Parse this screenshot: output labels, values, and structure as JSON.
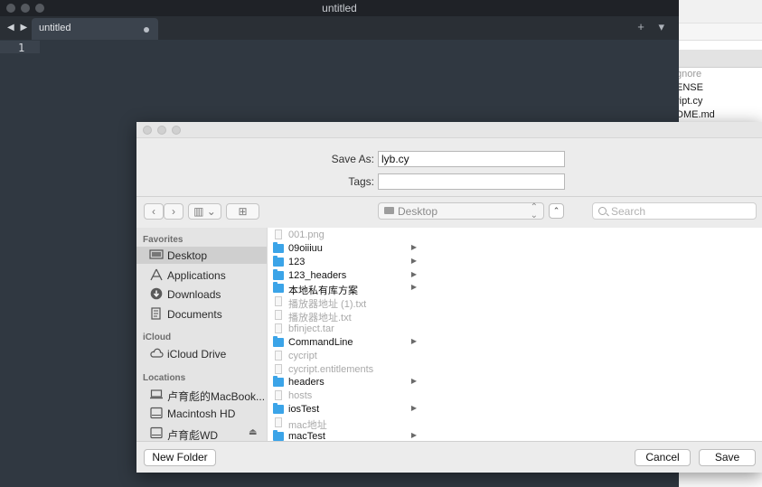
{
  "editor": {
    "window_title": "untitled",
    "nav_arrows": "◀ ▶",
    "tab_label": "untitled",
    "tab_actions": "+ ▾",
    "line_number": "1"
  },
  "background_finder": {
    "files": [
      {
        "name": "gnore",
        "dim": true
      },
      {
        "name": "ENSE",
        "dim": false
      },
      {
        "name": "ript.cy",
        "dim": false
      },
      {
        "name": "DME.md",
        "dim": false
      }
    ]
  },
  "dialog": {
    "save_as_label": "Save As:",
    "save_as_value": "lyb.cy",
    "tags_label": "Tags:",
    "tags_value": "",
    "back_glyph": "‹",
    "forward_glyph": "›",
    "view_glyph": "▥ ⌄",
    "new_folder_glyph": "⊞",
    "location": "Desktop",
    "location_arrows": "⌃⌄",
    "expand_glyph": "⌃",
    "search_placeholder": "Search",
    "sidebar": {
      "favorites_header": "Favorites",
      "favorites": [
        {
          "label": "Desktop",
          "icon": "desktop-icon",
          "selected": true
        },
        {
          "label": "Applications",
          "icon": "applications-icon",
          "selected": false
        },
        {
          "label": "Downloads",
          "icon": "downloads-icon",
          "selected": false
        },
        {
          "label": "Documents",
          "icon": "documents-icon",
          "selected": false
        }
      ],
      "icloud_header": "iCloud",
      "icloud": [
        {
          "label": "iCloud Drive",
          "icon": "cloud-icon"
        }
      ],
      "locations_header": "Locations",
      "locations": [
        {
          "label": "卢育彪的MacBook...",
          "icon": "laptop-icon"
        },
        {
          "label": "Macintosh HD",
          "icon": "disk-icon"
        },
        {
          "label": "卢育彪WD",
          "icon": "external-disk-icon",
          "eject": "⏏"
        }
      ]
    },
    "files": [
      {
        "name": "001.png",
        "type": "doc",
        "dim": true,
        "chevron": ""
      },
      {
        "name": "09oiiiuu",
        "type": "folder",
        "dim": false,
        "chevron": "▶"
      },
      {
        "name": "123",
        "type": "folder",
        "dim": false,
        "chevron": "▶"
      },
      {
        "name": "123_headers",
        "type": "folder",
        "dim": false,
        "chevron": "▶"
      },
      {
        "name": "本地私有库方案",
        "type": "folder",
        "dim": false,
        "chevron": "▶"
      },
      {
        "name": "播放器地址 (1).txt",
        "type": "doc",
        "dim": true,
        "chevron": ""
      },
      {
        "name": "播放器地址.txt",
        "type": "doc",
        "dim": true,
        "chevron": ""
      },
      {
        "name": "bfinject.tar",
        "type": "doc",
        "dim": true,
        "chevron": ""
      },
      {
        "name": "CommandLine",
        "type": "folder",
        "dim": false,
        "chevron": "▶"
      },
      {
        "name": "cycript",
        "type": "doc",
        "dim": true,
        "chevron": ""
      },
      {
        "name": "cycript.entitlements",
        "type": "doc",
        "dim": true,
        "chevron": ""
      },
      {
        "name": "headers",
        "type": "folder",
        "dim": false,
        "chevron": "▶"
      },
      {
        "name": "hosts",
        "type": "doc",
        "dim": true,
        "chevron": ""
      },
      {
        "name": "iosTest",
        "type": "folder",
        "dim": false,
        "chevron": "▶"
      },
      {
        "name": "mac地址",
        "type": "doc",
        "dim": true,
        "chevron": ""
      },
      {
        "name": "macTest",
        "type": "folder",
        "dim": false,
        "chevron": "▶"
      }
    ],
    "new_folder_label": "New Folder",
    "cancel_label": "Cancel",
    "save_label": "Save"
  }
}
